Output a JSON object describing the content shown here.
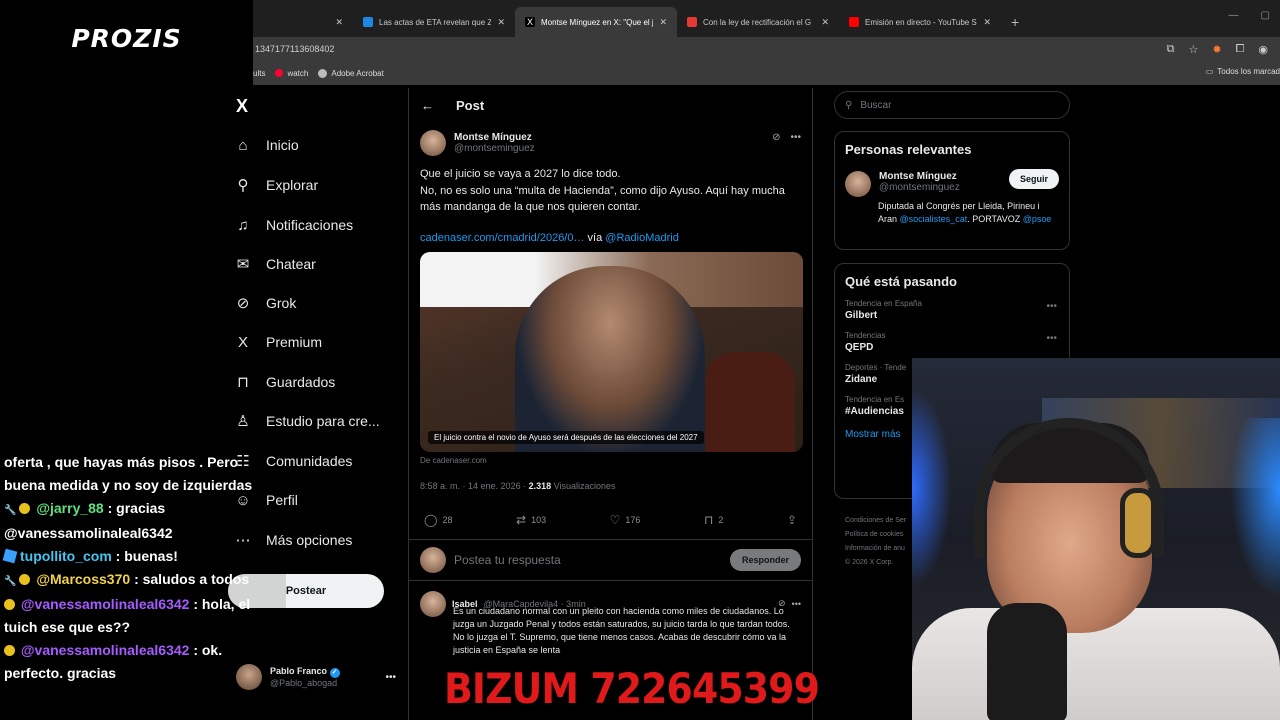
{
  "overlay": {
    "brand": "PROZIS",
    "bizum": "BIZUM 722645399"
  },
  "browser": {
    "tabs": [
      {
        "title": "",
        "favicon_color": "#444444"
      },
      {
        "title": "Las actas de ETA revelan que Z",
        "favicon_color": "#1e88e5"
      },
      {
        "title": "Montse Mínguez en X: \"Que el j",
        "favicon_color": "#000000"
      },
      {
        "title": "Con la ley de rectificación el G",
        "favicon_color": "#e53935"
      },
      {
        "title": "Emisión en directo - YouTube S",
        "favicon_color": "#ff0000"
      }
    ],
    "url": "1347177113608402",
    "bookmarks": [
      "ults",
      "watch",
      "Adobe Acrobat"
    ],
    "bookmarks_all": "Todos los marcad"
  },
  "nav": {
    "logo": "X",
    "items": [
      {
        "label": "Inicio",
        "icon": "home-icon",
        "glyph": "⌂"
      },
      {
        "label": "Explorar",
        "icon": "search-icon",
        "glyph": "⚲"
      },
      {
        "label": "Notificaciones",
        "icon": "bell-icon",
        "glyph": "🔔"
      },
      {
        "label": "Chatear",
        "icon": "mail-icon",
        "glyph": "✉"
      },
      {
        "label": "Grok",
        "icon": "grok-icon",
        "glyph": "⊘"
      },
      {
        "label": "Premium",
        "icon": "x-premium-icon",
        "glyph": "X"
      },
      {
        "label": "Guardados",
        "icon": "bookmark-icon",
        "glyph": "⊓"
      },
      {
        "label": "Estudio para cre...",
        "icon": "studio-icon",
        "glyph": "♙"
      },
      {
        "label": "Comunidades",
        "icon": "communities-icon",
        "glyph": "☷"
      },
      {
        "label": "Perfil",
        "icon": "profile-icon",
        "glyph": "☺"
      },
      {
        "label": "Más opciones",
        "icon": "more-icon",
        "glyph": "⋯"
      }
    ],
    "post_button": "Postear",
    "account": {
      "name": "Pablo Franco",
      "handle": "@Pablo_abogad"
    }
  },
  "main": {
    "title": "Post",
    "tweet": {
      "author": "Montse Mínguez",
      "handle": "@montseminguez",
      "text_1": "Que el juicio se vaya a 2027 lo dice todo.",
      "text_2": "No, no es solo una “multa de Hacienda”, como dijo Ayuso. Aquí hay mucha más mandanga de la que nos quieren contar.",
      "link": "cadenaser.com/cmadrid/2026/0…",
      "via": "vía",
      "via_account": "@RadioMadrid",
      "media_caption": "El juicio contra el novio de Ayuso será después de las elecciones del 2027",
      "source": "De cadenaser.com",
      "timestamp": "8:58 a. m. · 14 ene. 2026 ·",
      "views_count": "2.318",
      "views_label": "Visualizaciones",
      "replies": "28",
      "reposts": "103",
      "likes": "176",
      "bookmarks": "2"
    },
    "reply_placeholder": "Postea tu respuesta",
    "reply_button": "Responder",
    "first_reply": {
      "name": "Isabel",
      "handle": "@MaraCapdevila4 · 3min",
      "text": "Es un ciudadano normal con un pleito con hacienda como miles de ciudadanos. Lo juzga un Juzgado Penal y todos están saturados, su juicio tarda lo que tardan todos. No lo juzga el T. Supremo, que tiene menos casos. Acabas de descubrir cómo va la justicia en España se lenta"
    }
  },
  "sidebar": {
    "search_placeholder": "Buscar",
    "relevant_title": "Personas relevantes",
    "relevant_user": {
      "name": "Montse Mínguez",
      "handle": "@montseminguez",
      "follow": "Seguir",
      "bio_1": "Diputada al Congrés per Lleida, Pirineu i Aran",
      "bio_mention_1": "@socialistes_cat",
      "bio_2": ". PORTAVOZ",
      "bio_mention_2": "@psoe"
    },
    "trends_title": "Qué está pasando",
    "trends": [
      {
        "context": "Tendencia en España",
        "title": "Gilbert"
      },
      {
        "context": "Tendencias",
        "title": "QEPD"
      },
      {
        "context": "Deportes · Tende",
        "title": "Zidane"
      },
      {
        "context": "Tendencia en Es",
        "title": "#Audiencias"
      }
    ],
    "show_more": "Mostrar más",
    "footer": [
      "Condiciones de Ser",
      "Política de cookies",
      "Información de anu",
      "© 2026 X Corp."
    ]
  },
  "chat": [
    {
      "user": "",
      "text": "oferta , que hayas más pisos . Pero"
    },
    {
      "user": "",
      "text": "buena medida y no soy de izquierdas"
    },
    {
      "user": "@jarry_88",
      "text": ": gracias"
    },
    {
      "user": "",
      "text": "@vanessamolinaleal6342"
    },
    {
      "user": "tupollito_com",
      "text": ": buenas!"
    },
    {
      "user": "@Marcoss370",
      "text": ": saludos a todos"
    },
    {
      "user": "@vanessamolinaleal6342",
      "text": ": hola, el"
    },
    {
      "user": "",
      "text": "tuich ese que es??"
    },
    {
      "user": "@vanessamolinaleal6342",
      "text": ": ok."
    },
    {
      "user": "",
      "text": "perfecto. gracias"
    }
  ]
}
